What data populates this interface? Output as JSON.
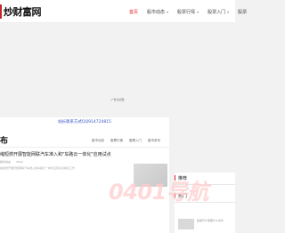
{
  "header": {
    "logo_text": "炒财富网",
    "nav": [
      {
        "label": "首页",
        "active": true,
        "has_caret": false
      },
      {
        "label": "股市动态",
        "active": false,
        "has_caret": true
      },
      {
        "label": "股票行情",
        "active": false,
        "has_caret": true
      },
      {
        "label": "股票入门",
        "active": false,
        "has_caret": true
      },
      {
        "label": "股票",
        "active": false,
        "has_caret": false
      }
    ],
    "caret_glyph": "▾"
  },
  "banner": {
    "caption": "广告位招租"
  },
  "main": {
    "contact": "站长联系方式QQ914724815",
    "section_title": "布",
    "tabs": [
      "股市动态",
      "股票行情",
      "股票入门",
      "股市资讯"
    ],
    "article": {
      "title": "缩短燃开展智能网联汽车准入和\"车路云一体化\"应用试点",
      "meta": [
        "股市动态",
        "2024"
      ],
      "snippet": "缩短燃开展智能网联汽车准入和车路云一体化应用试点相关工作"
    }
  },
  "sidebar": {
    "recommend_title": "推荐",
    "hot_title": "热门",
    "hot_item_text": "股票开户需要什么条件"
  },
  "watermark": "0401导航"
}
